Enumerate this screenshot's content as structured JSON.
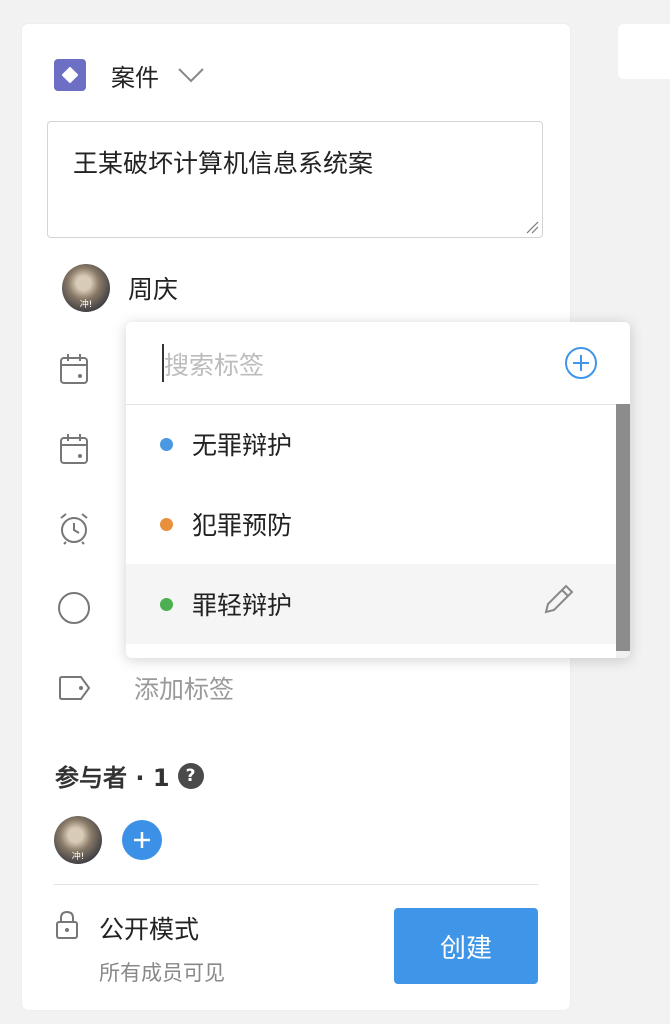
{
  "header": {
    "type_label": "案件"
  },
  "title_input": {
    "value": "王某破坏计算机信息系统案"
  },
  "owner": {
    "name": "周庆",
    "avatar_text": "冲!"
  },
  "tag_popup": {
    "search_placeholder": "搜索标签",
    "tags": [
      {
        "label": "无罪辩护",
        "color": "#4a98e2"
      },
      {
        "label": "犯罪预防",
        "color": "#e8903c"
      },
      {
        "label": "罪轻辩护",
        "color": "#4caf50"
      }
    ]
  },
  "add_tag_label": "添加标签",
  "participants": {
    "label": "参与者 · 1",
    "help": "?"
  },
  "visibility": {
    "title": "公开模式",
    "subtitle": "所有成员可见"
  },
  "create_button": "创建",
  "colors": {
    "accent": "#3f96e8",
    "type_icon": "#6c6fc4"
  }
}
